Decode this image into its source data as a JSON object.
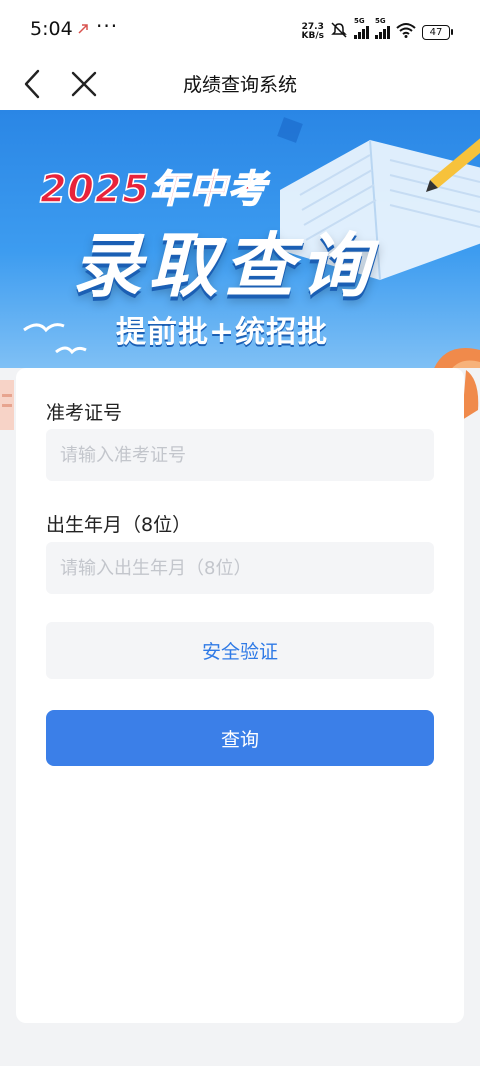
{
  "status_bar": {
    "time": "5:04",
    "dots": "···",
    "net_speed_value": "27.3",
    "net_speed_unit": "KB/s",
    "sim1_label": "5G",
    "sim2_label": "5G",
    "battery": "47",
    "icons": [
      "notification-icon",
      "mute-icon",
      "signal-icon",
      "wifi-icon",
      "battery-icon"
    ]
  },
  "nav": {
    "title": "成绩查询系统",
    "back_icon": "chevron-left-icon",
    "close_icon": "close-icon"
  },
  "banner": {
    "line1": "2025年中考",
    "line2": "录取查询",
    "line3": "提前批+统招批"
  },
  "form": {
    "exam_id": {
      "label": "准考证号",
      "value": "",
      "placeholder": "请输入准考证号"
    },
    "birth": {
      "label": "出生年月（8位）",
      "value": "",
      "placeholder": "请输入出生年月（8位）"
    },
    "verify_label": "安全验证",
    "submit_label": "查询"
  },
  "colors": {
    "primary": "#3b7fe8",
    "verify_text": "#2f7ae6",
    "banner_blue": "#2a86e5",
    "banner_red": "#e8233a"
  }
}
